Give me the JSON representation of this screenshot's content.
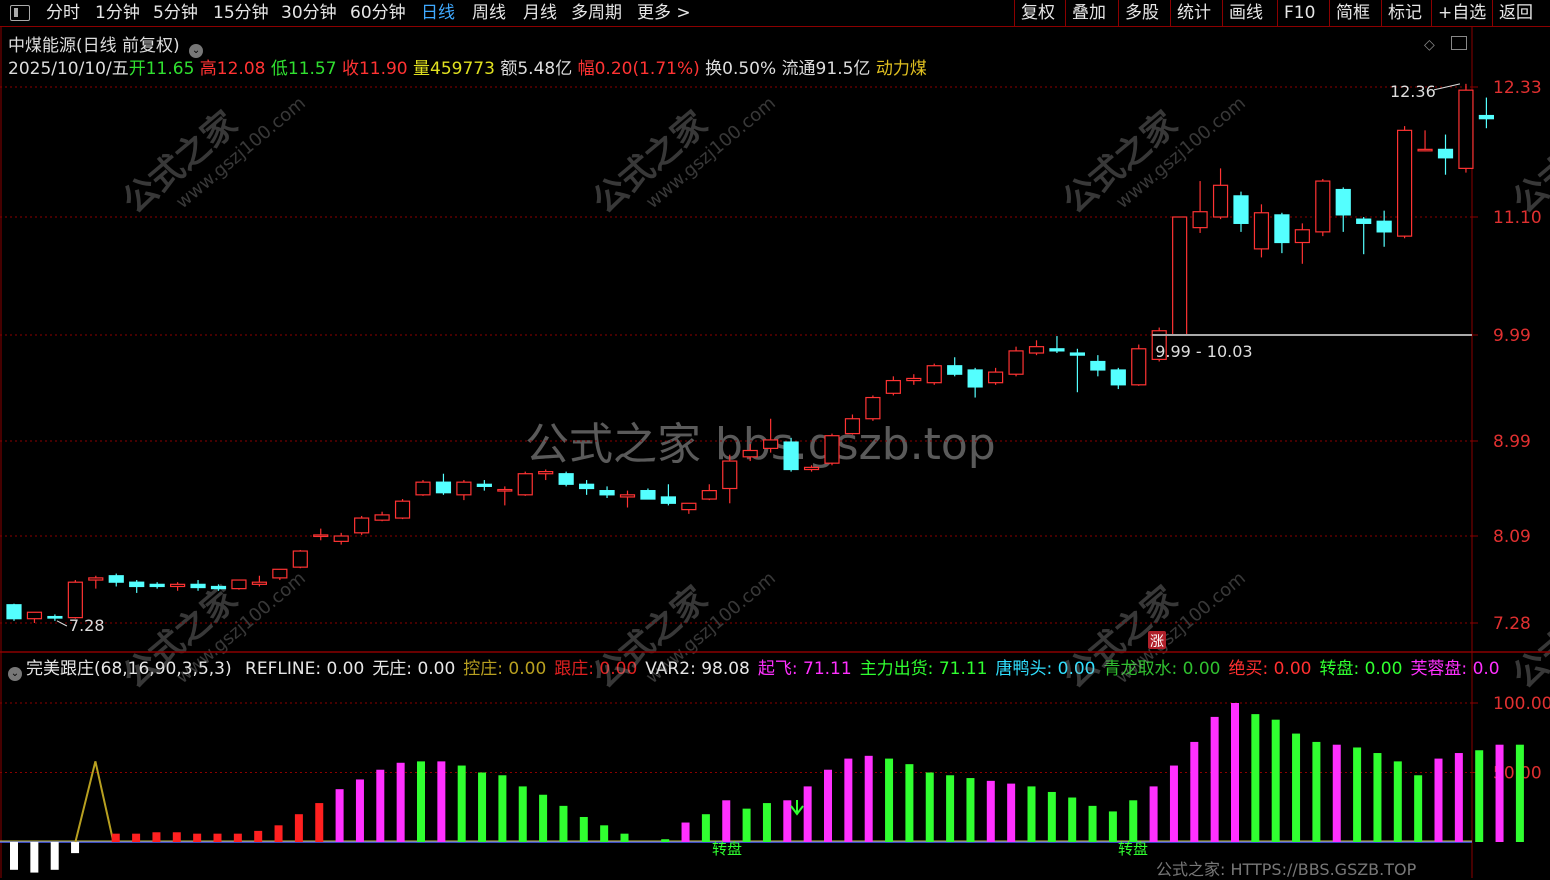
{
  "toolbar": {
    "left_items": [
      "分时",
      "1分钟",
      "5分钟",
      "15分钟",
      "30分钟",
      "60分钟",
      "日线",
      "周线",
      "月线",
      "多周期",
      "更多 >"
    ],
    "active_index": 6,
    "right_items": [
      "复权",
      "叠加",
      "多股",
      "统计",
      "画线",
      "F10",
      "简框",
      "标记",
      "+自选",
      "返回"
    ]
  },
  "header": {
    "stock_name": "中煤能源(日线 前复权)",
    "date": "2025/10/10/五",
    "open_label": "开",
    "open": "11.65",
    "high_label": "高",
    "high": "12.08",
    "low_label": "低",
    "low": "11.57",
    "close_label": "收",
    "close": "11.90",
    "vol_label": "量",
    "vol": "459773",
    "amt_label": "额",
    "amt": "5.48亿",
    "chg_label": "幅",
    "chg": "0.20(1.71%)",
    "turnover": "换0.50%",
    "float_cap": "流通91.5亿",
    "sector": "动力煤"
  },
  "indicator": {
    "name": "完美跟庄(68,16,90,3,5,3)",
    "items": [
      {
        "label": "REFLINE: 0.00",
        "color": "#e6e6e6"
      },
      {
        "label": "无庄: 0.00",
        "color": "#e6e6e6"
      },
      {
        "label": "控庄: 0.00",
        "color": "#b8a020"
      },
      {
        "label": "跟庄: 0.00",
        "color": "#e02020"
      },
      {
        "label": "VAR2: 98.08",
        "color": "#e6e6e6"
      },
      {
        "label": "起飞: 71.11",
        "color": "#ff30ff"
      },
      {
        "label": "主力出货: 71.11",
        "color": "#30ff30"
      },
      {
        "label": "唐鸭头: 0.00",
        "color": "#30e0ff"
      },
      {
        "label": "青龙取水: 0.00",
        "color": "#30c030"
      },
      {
        "label": "绝买: 0.00",
        "color": "#ff3030"
      },
      {
        "label": "转盘: 0.00",
        "color": "#30ff30"
      },
      {
        "label": "芙蓉盘: 0.0",
        "color": "#ff30ff"
      }
    ],
    "zhuanpan_label": "转盘",
    "zhang_label": "涨"
  },
  "watermarks": {
    "center": "公式之家 bbs.gszb.top",
    "bottom": "公式之家: HTTPS://BBS.GSZB.TOP",
    "diag_cn": "公式之家",
    "diag_url": "www.gszj100.com"
  },
  "colors": {
    "up": "#ff3333",
    "down": "#54ffff",
    "grid": "#8b0000",
    "axis": "#e03030"
  },
  "chart_data": [
    {
      "type": "candlestick",
      "y_ticks": [
        7.28,
        8.09,
        8.99,
        9.99,
        11.1,
        12.33
      ],
      "annotations": {
        "max_label": "12.36",
        "min_label": "7.28",
        "gap_label": "9.99 - 10.03",
        "gap_level": 9.99
      },
      "candles": [
        {
          "o": 7.45,
          "h": 7.46,
          "l": 7.3,
          "c": 7.32
        },
        {
          "o": 7.32,
          "h": 7.38,
          "l": 7.28,
          "c": 7.38
        },
        {
          "o": 7.34,
          "h": 7.36,
          "l": 7.3,
          "c": 7.33
        },
        {
          "o": 7.33,
          "h": 7.68,
          "l": 7.32,
          "c": 7.66
        },
        {
          "o": 7.68,
          "h": 7.72,
          "l": 7.6,
          "c": 7.7
        },
        {
          "o": 7.72,
          "h": 7.74,
          "l": 7.62,
          "c": 7.66
        },
        {
          "o": 7.66,
          "h": 7.68,
          "l": 7.56,
          "c": 7.62
        },
        {
          "o": 7.64,
          "h": 7.66,
          "l": 7.6,
          "c": 7.62
        },
        {
          "o": 7.62,
          "h": 7.66,
          "l": 7.58,
          "c": 7.64
        },
        {
          "o": 7.64,
          "h": 7.68,
          "l": 7.58,
          "c": 7.61
        },
        {
          "o": 7.62,
          "h": 7.64,
          "l": 7.58,
          "c": 7.6
        },
        {
          "o": 7.6,
          "h": 7.68,
          "l": 7.59,
          "c": 7.68
        },
        {
          "o": 7.64,
          "h": 7.72,
          "l": 7.62,
          "c": 7.66
        },
        {
          "o": 7.7,
          "h": 7.78,
          "l": 7.68,
          "c": 7.78
        },
        {
          "o": 7.8,
          "h": 7.96,
          "l": 7.79,
          "c": 7.95
        },
        {
          "o": 8.1,
          "h": 8.16,
          "l": 8.05,
          "c": 8.1
        },
        {
          "o": 8.04,
          "h": 8.12,
          "l": 8.01,
          "c": 8.09
        },
        {
          "o": 8.12,
          "h": 8.28,
          "l": 8.1,
          "c": 8.26
        },
        {
          "o": 8.24,
          "h": 8.32,
          "l": 8.23,
          "c": 8.29
        },
        {
          "o": 8.26,
          "h": 8.44,
          "l": 8.25,
          "c": 8.42
        },
        {
          "o": 8.48,
          "h": 8.62,
          "l": 8.47,
          "c": 8.6
        },
        {
          "o": 8.6,
          "h": 8.68,
          "l": 8.48,
          "c": 8.5
        },
        {
          "o": 8.48,
          "h": 8.62,
          "l": 8.43,
          "c": 8.6
        },
        {
          "o": 8.58,
          "h": 8.62,
          "l": 8.52,
          "c": 8.56
        },
        {
          "o": 8.52,
          "h": 8.56,
          "l": 8.38,
          "c": 8.53
        },
        {
          "o": 8.48,
          "h": 8.7,
          "l": 8.47,
          "c": 8.68
        },
        {
          "o": 8.68,
          "h": 8.72,
          "l": 8.62,
          "c": 8.7
        },
        {
          "o": 8.68,
          "h": 8.7,
          "l": 8.56,
          "c": 8.58
        },
        {
          "o": 8.58,
          "h": 8.62,
          "l": 8.48,
          "c": 8.54
        },
        {
          "o": 8.52,
          "h": 8.56,
          "l": 8.45,
          "c": 8.48
        },
        {
          "o": 8.46,
          "h": 8.52,
          "l": 8.36,
          "c": 8.48
        },
        {
          "o": 8.52,
          "h": 8.54,
          "l": 8.44,
          "c": 8.44
        },
        {
          "o": 8.46,
          "h": 8.58,
          "l": 8.38,
          "c": 8.4
        },
        {
          "o": 8.34,
          "h": 8.4,
          "l": 8.3,
          "c": 8.4
        },
        {
          "o": 8.44,
          "h": 8.58,
          "l": 8.43,
          "c": 8.52
        },
        {
          "o": 8.54,
          "h": 8.86,
          "l": 8.4,
          "c": 8.8
        },
        {
          "o": 8.84,
          "h": 8.96,
          "l": 8.8,
          "c": 8.9
        },
        {
          "o": 8.92,
          "h": 9.2,
          "l": 8.88,
          "c": 9.0
        },
        {
          "o": 8.98,
          "h": 9.02,
          "l": 8.7,
          "c": 8.72
        },
        {
          "o": 8.72,
          "h": 8.76,
          "l": 8.7,
          "c": 8.74
        },
        {
          "o": 8.78,
          "h": 9.06,
          "l": 8.76,
          "c": 9.04
        },
        {
          "o": 9.06,
          "h": 9.24,
          "l": 9.05,
          "c": 9.2
        },
        {
          "o": 9.2,
          "h": 9.42,
          "l": 9.18,
          "c": 9.4
        },
        {
          "o": 9.44,
          "h": 9.6,
          "l": 9.42,
          "c": 9.56
        },
        {
          "o": 9.56,
          "h": 9.62,
          "l": 9.52,
          "c": 9.58
        },
        {
          "o": 9.54,
          "h": 9.72,
          "l": 9.52,
          "c": 9.7
        },
        {
          "o": 9.7,
          "h": 9.78,
          "l": 9.6,
          "c": 9.62
        },
        {
          "o": 9.66,
          "h": 9.68,
          "l": 9.4,
          "c": 9.5
        },
        {
          "o": 9.54,
          "h": 9.68,
          "l": 9.52,
          "c": 9.64
        },
        {
          "o": 9.62,
          "h": 9.88,
          "l": 9.6,
          "c": 9.84
        },
        {
          "o": 9.82,
          "h": 9.94,
          "l": 9.8,
          "c": 9.88
        },
        {
          "o": 9.86,
          "h": 9.98,
          "l": 9.82,
          "c": 9.84
        },
        {
          "o": 9.82,
          "h": 9.86,
          "l": 9.45,
          "c": 9.8
        },
        {
          "o": 9.74,
          "h": 9.8,
          "l": 9.6,
          "c": 9.66
        },
        {
          "o": 9.66,
          "h": 9.68,
          "l": 9.48,
          "c": 9.52
        },
        {
          "o": 9.52,
          "h": 9.9,
          "l": 9.51,
          "c": 9.86
        },
        {
          "o": 9.76,
          "h": 10.06,
          "l": 9.74,
          "c": 10.03
        },
        {
          "o": 9.99,
          "h": 11.1,
          "l": 9.99,
          "c": 11.1
        },
        {
          "o": 11.0,
          "h": 11.44,
          "l": 10.95,
          "c": 11.15
        },
        {
          "o": 11.1,
          "h": 11.56,
          "l": 11.08,
          "c": 11.4
        },
        {
          "o": 11.3,
          "h": 11.34,
          "l": 10.96,
          "c": 11.04
        },
        {
          "o": 10.8,
          "h": 11.22,
          "l": 10.72,
          "c": 11.14
        },
        {
          "o": 11.12,
          "h": 11.14,
          "l": 10.76,
          "c": 10.86
        },
        {
          "o": 10.86,
          "h": 11.04,
          "l": 10.66,
          "c": 10.98
        },
        {
          "o": 10.96,
          "h": 11.46,
          "l": 10.92,
          "c": 11.44
        },
        {
          "o": 11.36,
          "h": 11.38,
          "l": 10.96,
          "c": 11.12
        },
        {
          "o": 11.08,
          "h": 11.1,
          "l": 10.75,
          "c": 11.04
        },
        {
          "o": 11.06,
          "h": 11.16,
          "l": 10.82,
          "c": 10.96
        },
        {
          "o": 10.92,
          "h": 11.96,
          "l": 10.9,
          "c": 11.92
        },
        {
          "o": 11.74,
          "h": 11.92,
          "l": 11.72,
          "c": 11.74
        },
        {
          "o": 11.74,
          "h": 11.88,
          "l": 11.5,
          "c": 11.66
        },
        {
          "o": 11.56,
          "h": 12.36,
          "l": 11.52,
          "c": 12.3
        },
        {
          "o": 12.06,
          "h": 12.23,
          "l": 11.94,
          "c": 12.03
        }
      ]
    },
    {
      "type": "bar",
      "y_ticks": [
        50.0,
        100.0
      ],
      "bars": [
        {
          "v": -20,
          "c": "w"
        },
        {
          "v": -22,
          "c": "w"
        },
        {
          "v": -20,
          "c": "w"
        },
        {
          "v": -8,
          "c": "w"
        },
        {
          "v": 58,
          "c": "line"
        },
        {
          "v": 6,
          "c": "r"
        },
        {
          "v": 6,
          "c": "r"
        },
        {
          "v": 7,
          "c": "r"
        },
        {
          "v": 7,
          "c": "r"
        },
        {
          "v": 6,
          "c": "r"
        },
        {
          "v": 6,
          "c": "r"
        },
        {
          "v": 6,
          "c": "r"
        },
        {
          "v": 8,
          "c": "r"
        },
        {
          "v": 12,
          "c": "r"
        },
        {
          "v": 20,
          "c": "r"
        },
        {
          "v": 28,
          "c": "r"
        },
        {
          "v": 38,
          "c": "m"
        },
        {
          "v": 45,
          "c": "m"
        },
        {
          "v": 52,
          "c": "m"
        },
        {
          "v": 57,
          "c": "m"
        },
        {
          "v": 58,
          "c": "g"
        },
        {
          "v": 58,
          "c": "m"
        },
        {
          "v": 55,
          "c": "g"
        },
        {
          "v": 50,
          "c": "g"
        },
        {
          "v": 48,
          "c": "g"
        },
        {
          "v": 40,
          "c": "g"
        },
        {
          "v": 34,
          "c": "g"
        },
        {
          "v": 26,
          "c": "g"
        },
        {
          "v": 18,
          "c": "g"
        },
        {
          "v": 12,
          "c": "g"
        },
        {
          "v": 6,
          "c": "g"
        },
        {
          "v": 0,
          "c": "g"
        },
        {
          "v": 2,
          "c": "g"
        },
        {
          "v": 14,
          "c": "m"
        },
        {
          "v": 20,
          "c": "g"
        },
        {
          "v": 30,
          "c": "m"
        },
        {
          "v": 24,
          "c": "g"
        },
        {
          "v": 28,
          "c": "g"
        },
        {
          "v": 30,
          "c": "m"
        },
        {
          "v": 40,
          "c": "m"
        },
        {
          "v": 52,
          "c": "m"
        },
        {
          "v": 60,
          "c": "m"
        },
        {
          "v": 62,
          "c": "m"
        },
        {
          "v": 60,
          "c": "g"
        },
        {
          "v": 56,
          "c": "g"
        },
        {
          "v": 50,
          "c": "g"
        },
        {
          "v": 48,
          "c": "g"
        },
        {
          "v": 46,
          "c": "g"
        },
        {
          "v": 44,
          "c": "m"
        },
        {
          "v": 42,
          "c": "m"
        },
        {
          "v": 40,
          "c": "g"
        },
        {
          "v": 36,
          "c": "g"
        },
        {
          "v": 32,
          "c": "g"
        },
        {
          "v": 26,
          "c": "g"
        },
        {
          "v": 22,
          "c": "g"
        },
        {
          "v": 30,
          "c": "g"
        },
        {
          "v": 40,
          "c": "m"
        },
        {
          "v": 55,
          "c": "m"
        },
        {
          "v": 72,
          "c": "m"
        },
        {
          "v": 90,
          "c": "m"
        },
        {
          "v": 100,
          "c": "m"
        },
        {
          "v": 92,
          "c": "g"
        },
        {
          "v": 88,
          "c": "g"
        },
        {
          "v": 78,
          "c": "g"
        },
        {
          "v": 72,
          "c": "g"
        },
        {
          "v": 70,
          "c": "m"
        },
        {
          "v": 68,
          "c": "g"
        },
        {
          "v": 64,
          "c": "g"
        },
        {
          "v": 58,
          "c": "g"
        },
        {
          "v": 48,
          "c": "g"
        },
        {
          "v": 60,
          "c": "m"
        },
        {
          "v": 64,
          "c": "m"
        },
        {
          "v": 66,
          "c": "g"
        },
        {
          "v": 70,
          "c": "m"
        },
        {
          "v": 70,
          "c": "g"
        }
      ]
    }
  ]
}
